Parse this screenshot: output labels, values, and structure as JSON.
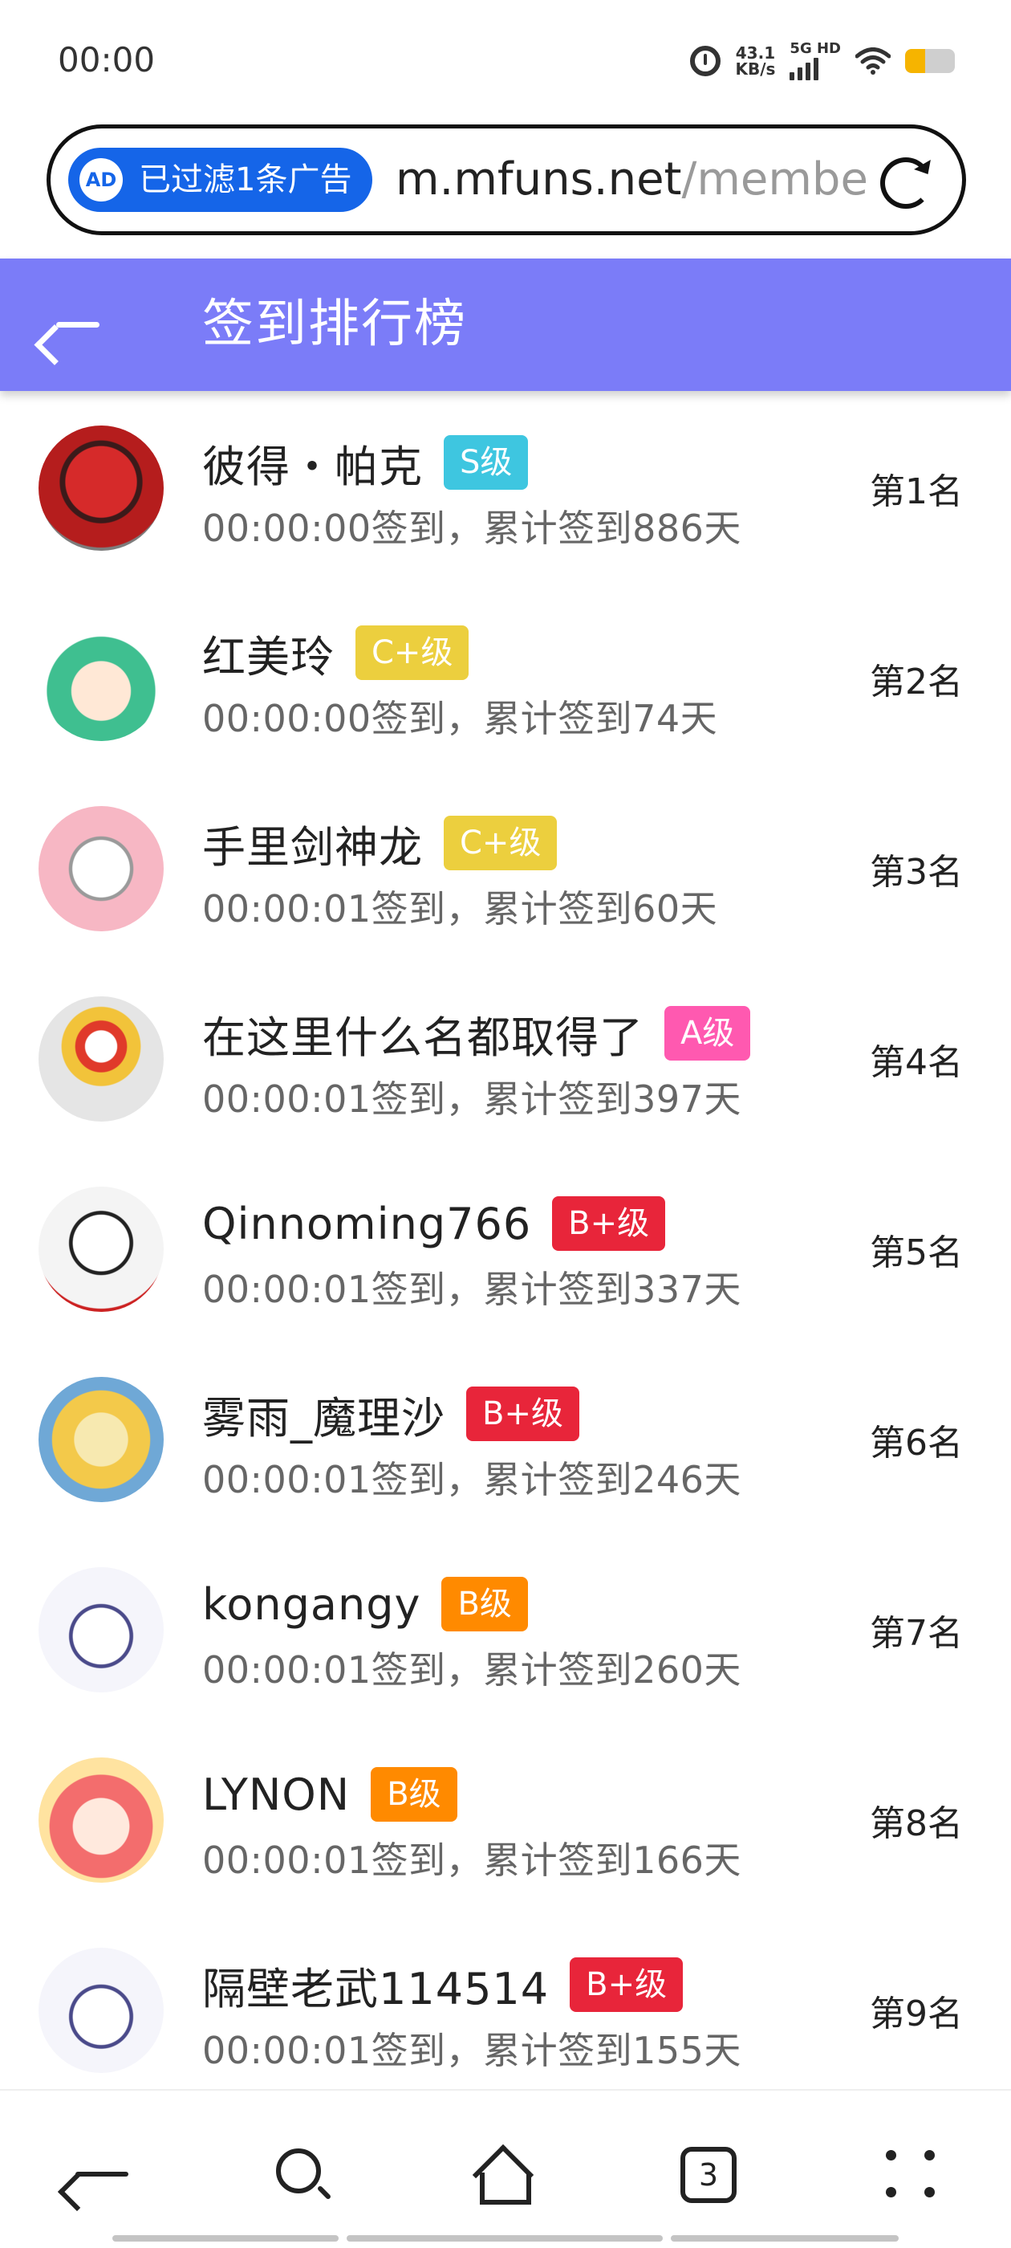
{
  "status_bar": {
    "time": "00:00",
    "net_speed_value": "43.1",
    "net_speed_unit": "KB/s",
    "network_type": "5G HD",
    "battery_level": 0.4,
    "icons": [
      "alarm-icon",
      "signal-icon",
      "wifi-icon",
      "battery-icon"
    ]
  },
  "address_bar": {
    "ad_filter_text": "已过滤1条广告",
    "ad_icon_text": "AD",
    "url_domain": "m.mfuns.net",
    "url_path": "/membe"
  },
  "header": {
    "title": "签到排行榜"
  },
  "colors": {
    "header_bg": "#7b7cf8",
    "badge_S": "#3ec6e0",
    "badge_C_plus": "#eccf3e",
    "badge_A": "#ff59b0",
    "badge_B_plus": "#e8253a",
    "badge_B": "#ff8a00",
    "ad_pill": "#1565e8"
  },
  "ranking": [
    {
      "name": "彼得・帕克",
      "level": "S级",
      "time": "00:00:00签到，",
      "total": "累计签到886天",
      "rank": "第1名"
    },
    {
      "name": "红美玲",
      "level": "C+级",
      "time": "00:00:00签到，",
      "total": "累计签到74天",
      "rank": "第2名"
    },
    {
      "name": "手里剑神龙",
      "level": "C+级",
      "time": "00:00:01签到，",
      "total": "累计签到60天",
      "rank": "第3名"
    },
    {
      "name": "在这里什么名都取得了",
      "level": "A级",
      "time": "00:00:01签到，",
      "total": "累计签到397天",
      "rank": "第4名"
    },
    {
      "name": "Qinnoming766",
      "level": "B+级",
      "time": "00:00:01签到，",
      "total": "累计签到337天",
      "rank": "第5名"
    },
    {
      "name": "雾雨_魔理沙",
      "level": "B+级",
      "time": "00:00:01签到，",
      "total": "累计签到246天",
      "rank": "第6名"
    },
    {
      "name": "kongangy",
      "level": "B级",
      "time": "00:00:01签到，",
      "total": "累计签到260天",
      "rank": "第7名"
    },
    {
      "name": "LYNON",
      "level": "B级",
      "time": "00:00:01签到，",
      "total": "累计签到166天",
      "rank": "第8名"
    },
    {
      "name": "隔壁老武114514",
      "level": "B+级",
      "time": "00:00:01签到，",
      "total": "累计签到155天",
      "rank": "第9名"
    }
  ],
  "bottom_nav": {
    "tab_count": "3",
    "items": [
      "back-icon",
      "search-icon",
      "home-icon",
      "tabs-icon",
      "menu-icon"
    ]
  }
}
